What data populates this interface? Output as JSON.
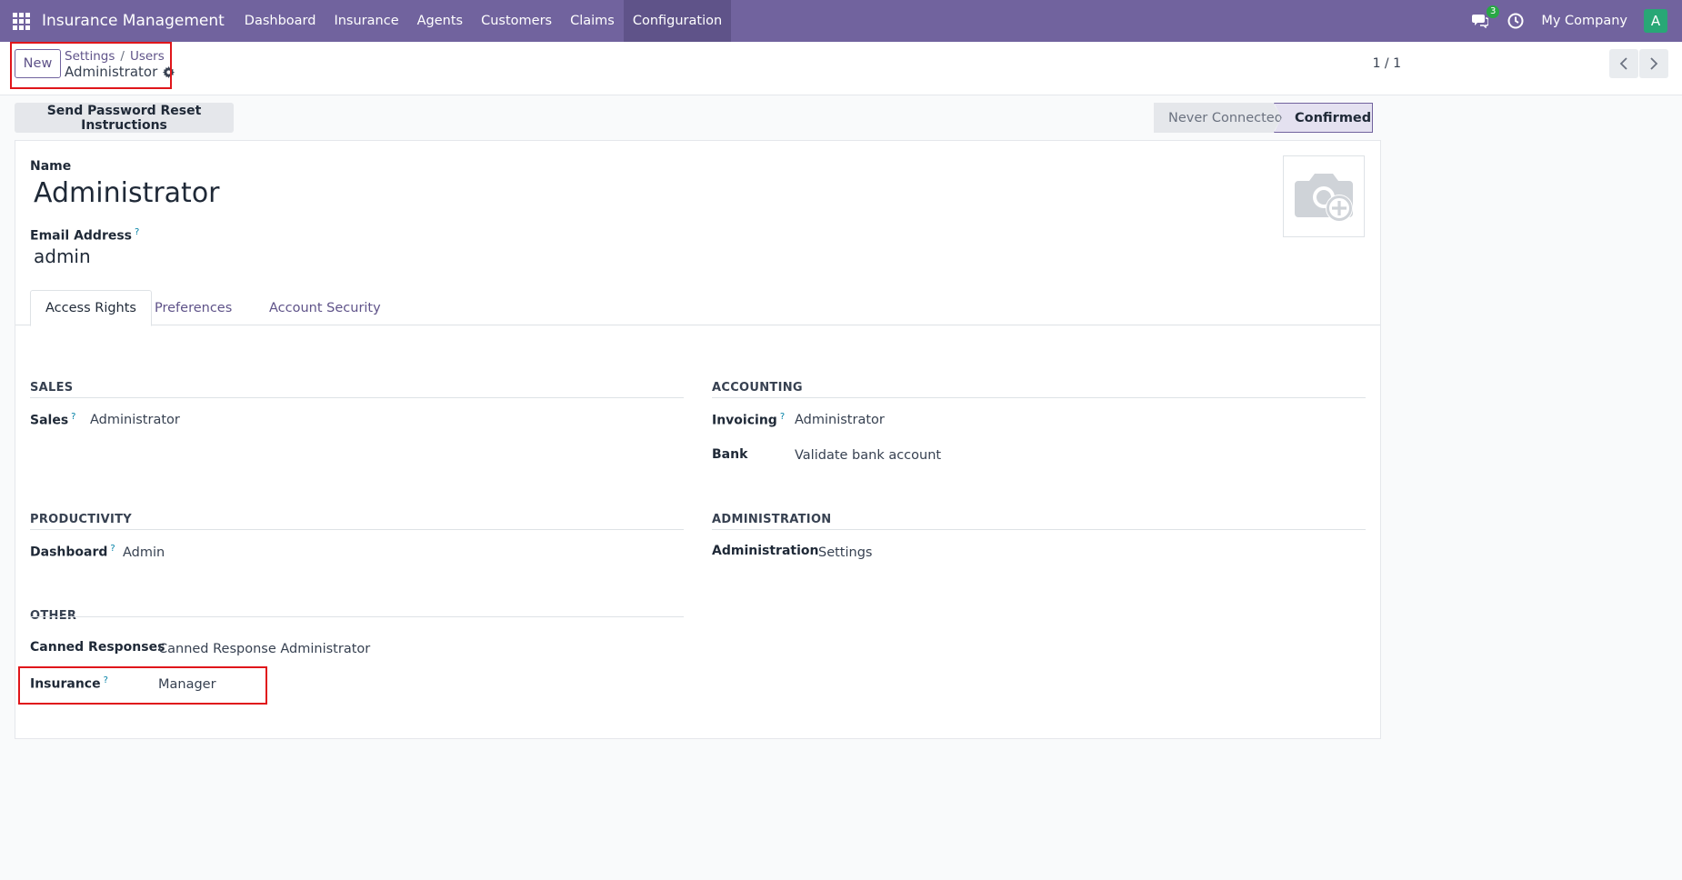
{
  "navbar": {
    "brand": "Insurance Management",
    "menu": [
      "Dashboard",
      "Insurance",
      "Agents",
      "Customers",
      "Claims",
      "Configuration"
    ],
    "notification_count": "3",
    "company": "My Company",
    "avatar_letter": "A"
  },
  "control_panel": {
    "new_label": "New",
    "breadcrumb": [
      "Settings",
      "Users"
    ],
    "record_title": "Administrator",
    "pager": "1 / 1"
  },
  "status": {
    "reset_button": "Send Password Reset Instructions",
    "stages": [
      "Never Connected",
      "Confirmed"
    ],
    "current_stage": "Confirmed"
  },
  "form": {
    "name_label": "Name",
    "name_value": "Administrator",
    "email_label": "Email Address",
    "email_value": "admin",
    "help_mark": "?",
    "tabs": [
      "Access Rights",
      "Preferences",
      "Account Security"
    ],
    "active_tab": "Access Rights",
    "groups": {
      "sales": {
        "title": "SALES",
        "fields": [
          {
            "label": "Sales",
            "value": "Administrator"
          }
        ]
      },
      "accounting": {
        "title": "ACCOUNTING",
        "fields": [
          {
            "label": "Invoicing",
            "value": "Administrator"
          },
          {
            "label": "Bank",
            "value": "Validate bank account"
          }
        ]
      },
      "productivity": {
        "title": "PRODUCTIVITY",
        "fields": [
          {
            "label": "Dashboard",
            "value": "Admin"
          }
        ]
      },
      "administration": {
        "title": "ADMINISTRATION",
        "fields": [
          {
            "label": "Administration",
            "value": "Settings"
          }
        ]
      },
      "other": {
        "title": "OTHER",
        "fields": [
          {
            "label": "Canned Responses",
            "value": "Canned Response Administrator"
          },
          {
            "label": "Insurance",
            "value": "Manager"
          }
        ]
      }
    }
  },
  "colors": {
    "navbar": "#71639e",
    "primary": "#5f5389",
    "highlight": "#e0161b",
    "help": "#0180a5"
  }
}
